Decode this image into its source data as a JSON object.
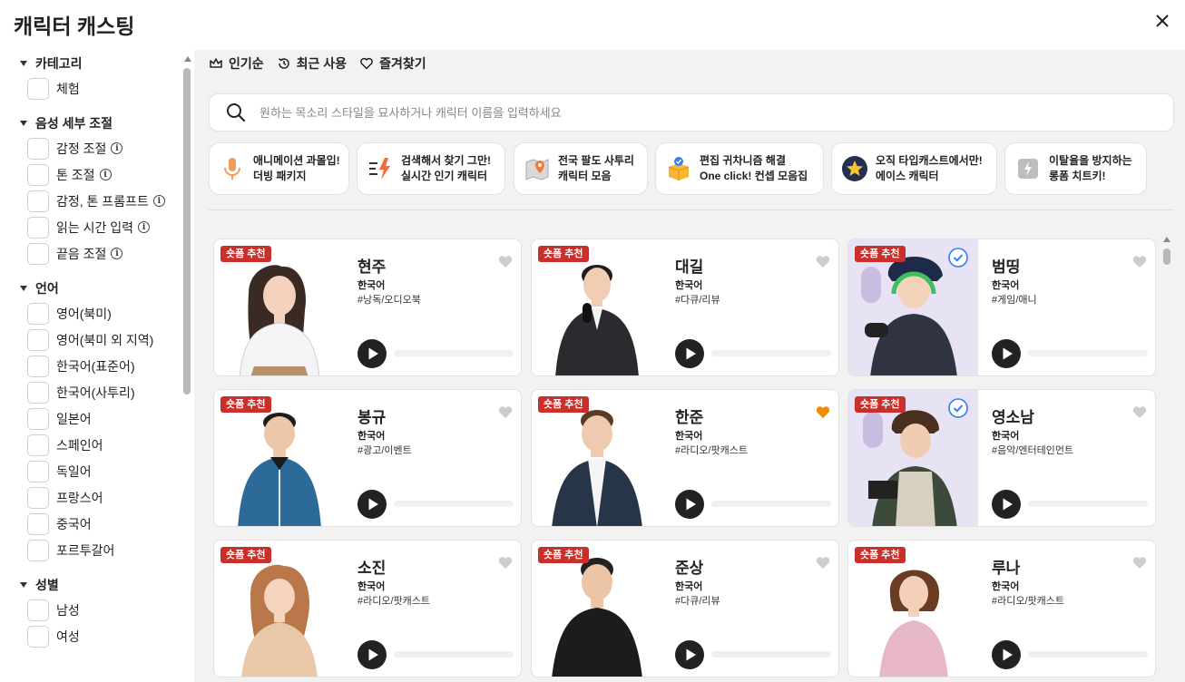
{
  "window": {
    "title": "캐릭터 캐스팅"
  },
  "sidebar": {
    "sections": [
      {
        "title": "카테고리",
        "options": [
          {
            "label": "체험"
          }
        ]
      },
      {
        "title": "음성 세부 조절",
        "options": [
          {
            "label": "감정 조절",
            "info": true
          },
          {
            "label": "톤 조절",
            "info": true
          },
          {
            "label": "감정, 톤 프롬프트",
            "info": true
          },
          {
            "label": "읽는 시간 입력",
            "info": true
          },
          {
            "label": "끝음 조절",
            "info": true
          }
        ]
      },
      {
        "title": "언어",
        "options": [
          {
            "label": "영어(북미)"
          },
          {
            "label": "영어(북미 외 지역)"
          },
          {
            "label": "한국어(표준어)"
          },
          {
            "label": "한국어(사투리)"
          },
          {
            "label": "일본어"
          },
          {
            "label": "스페인어"
          },
          {
            "label": "독일어"
          },
          {
            "label": "프랑스어"
          },
          {
            "label": "중국어"
          },
          {
            "label": "포르투갈어"
          }
        ]
      },
      {
        "title": "성별",
        "options": [
          {
            "label": "남성"
          },
          {
            "label": "여성"
          }
        ]
      }
    ]
  },
  "filters": {
    "popular": "인기순",
    "recent": "최근 사용",
    "favorites": "즐겨찾기"
  },
  "search": {
    "placeholder": "원하는 목소리 스타일을 묘사하거나 캐릭터 이름을 입력하세요"
  },
  "promos": [
    {
      "line1": "애니메이션 과몰입!",
      "line2": "더빙 패키지",
      "icon": "microphone-icon"
    },
    {
      "line1": "검색해서 찾기 그만!",
      "line2": "실시간 인기 캐릭터",
      "icon": "trending-icon"
    },
    {
      "line1": "전국 팔도 사투리",
      "line2": "캐릭터 모음",
      "icon": "map-pin-icon"
    },
    {
      "line1": "편집 귀차니즘 해결",
      "line2": "One click! 컨셉 모음집",
      "icon": "package-icon"
    },
    {
      "line1": "오직 타입캐스트에서만!",
      "line2": "에이스 캐릭터",
      "icon": "star-icon"
    },
    {
      "line1": "이탈율을 방지하는",
      "line2": "롱폼 치트키!",
      "icon": "lightning-icon"
    }
  ],
  "cards": [
    {
      "name": "현주",
      "lang": "한국어",
      "tag": "#낭독/오디오북",
      "badge": "숏폼 추천",
      "favorite": false,
      "ace": false
    },
    {
      "name": "대길",
      "lang": "한국어",
      "tag": "#다큐/리뷰",
      "badge": "숏폼 추천",
      "favorite": false,
      "ace": false
    },
    {
      "name": "범띵",
      "lang": "한국어",
      "tag": "#게임/애니",
      "badge": "숏폼 추천",
      "favorite": false,
      "ace": true
    },
    {
      "name": "봉규",
      "lang": "한국어",
      "tag": "#광고/이벤트",
      "badge": "숏폼 추천",
      "favorite": false,
      "ace": false
    },
    {
      "name": "한준",
      "lang": "한국어",
      "tag": "#라디오/팟캐스트",
      "badge": "숏폼 추천",
      "favorite": true,
      "ace": false
    },
    {
      "name": "영소남",
      "lang": "한국어",
      "tag": "#음악/엔터테인먼트",
      "badge": "숏폼 추천",
      "favorite": false,
      "ace": true
    },
    {
      "name": "소진",
      "lang": "한국어",
      "tag": "#라디오/팟캐스트",
      "badge": "숏폼 추천",
      "favorite": false,
      "ace": false
    },
    {
      "name": "준상",
      "lang": "한국어",
      "tag": "#다큐/리뷰",
      "badge": "숏폼 추천",
      "favorite": false,
      "ace": false
    },
    {
      "name": "루나",
      "lang": "한국어",
      "tag": "#라디오/팟캐스트",
      "badge": "숏폼 추천",
      "favorite": false,
      "ace": false
    }
  ],
  "colors": {
    "badge": "#c9302c",
    "favorite_heart": "#f28c00",
    "heart_default": "#cccccc",
    "verified": "#2f80ed",
    "main_bg": "#f2f2f2"
  }
}
